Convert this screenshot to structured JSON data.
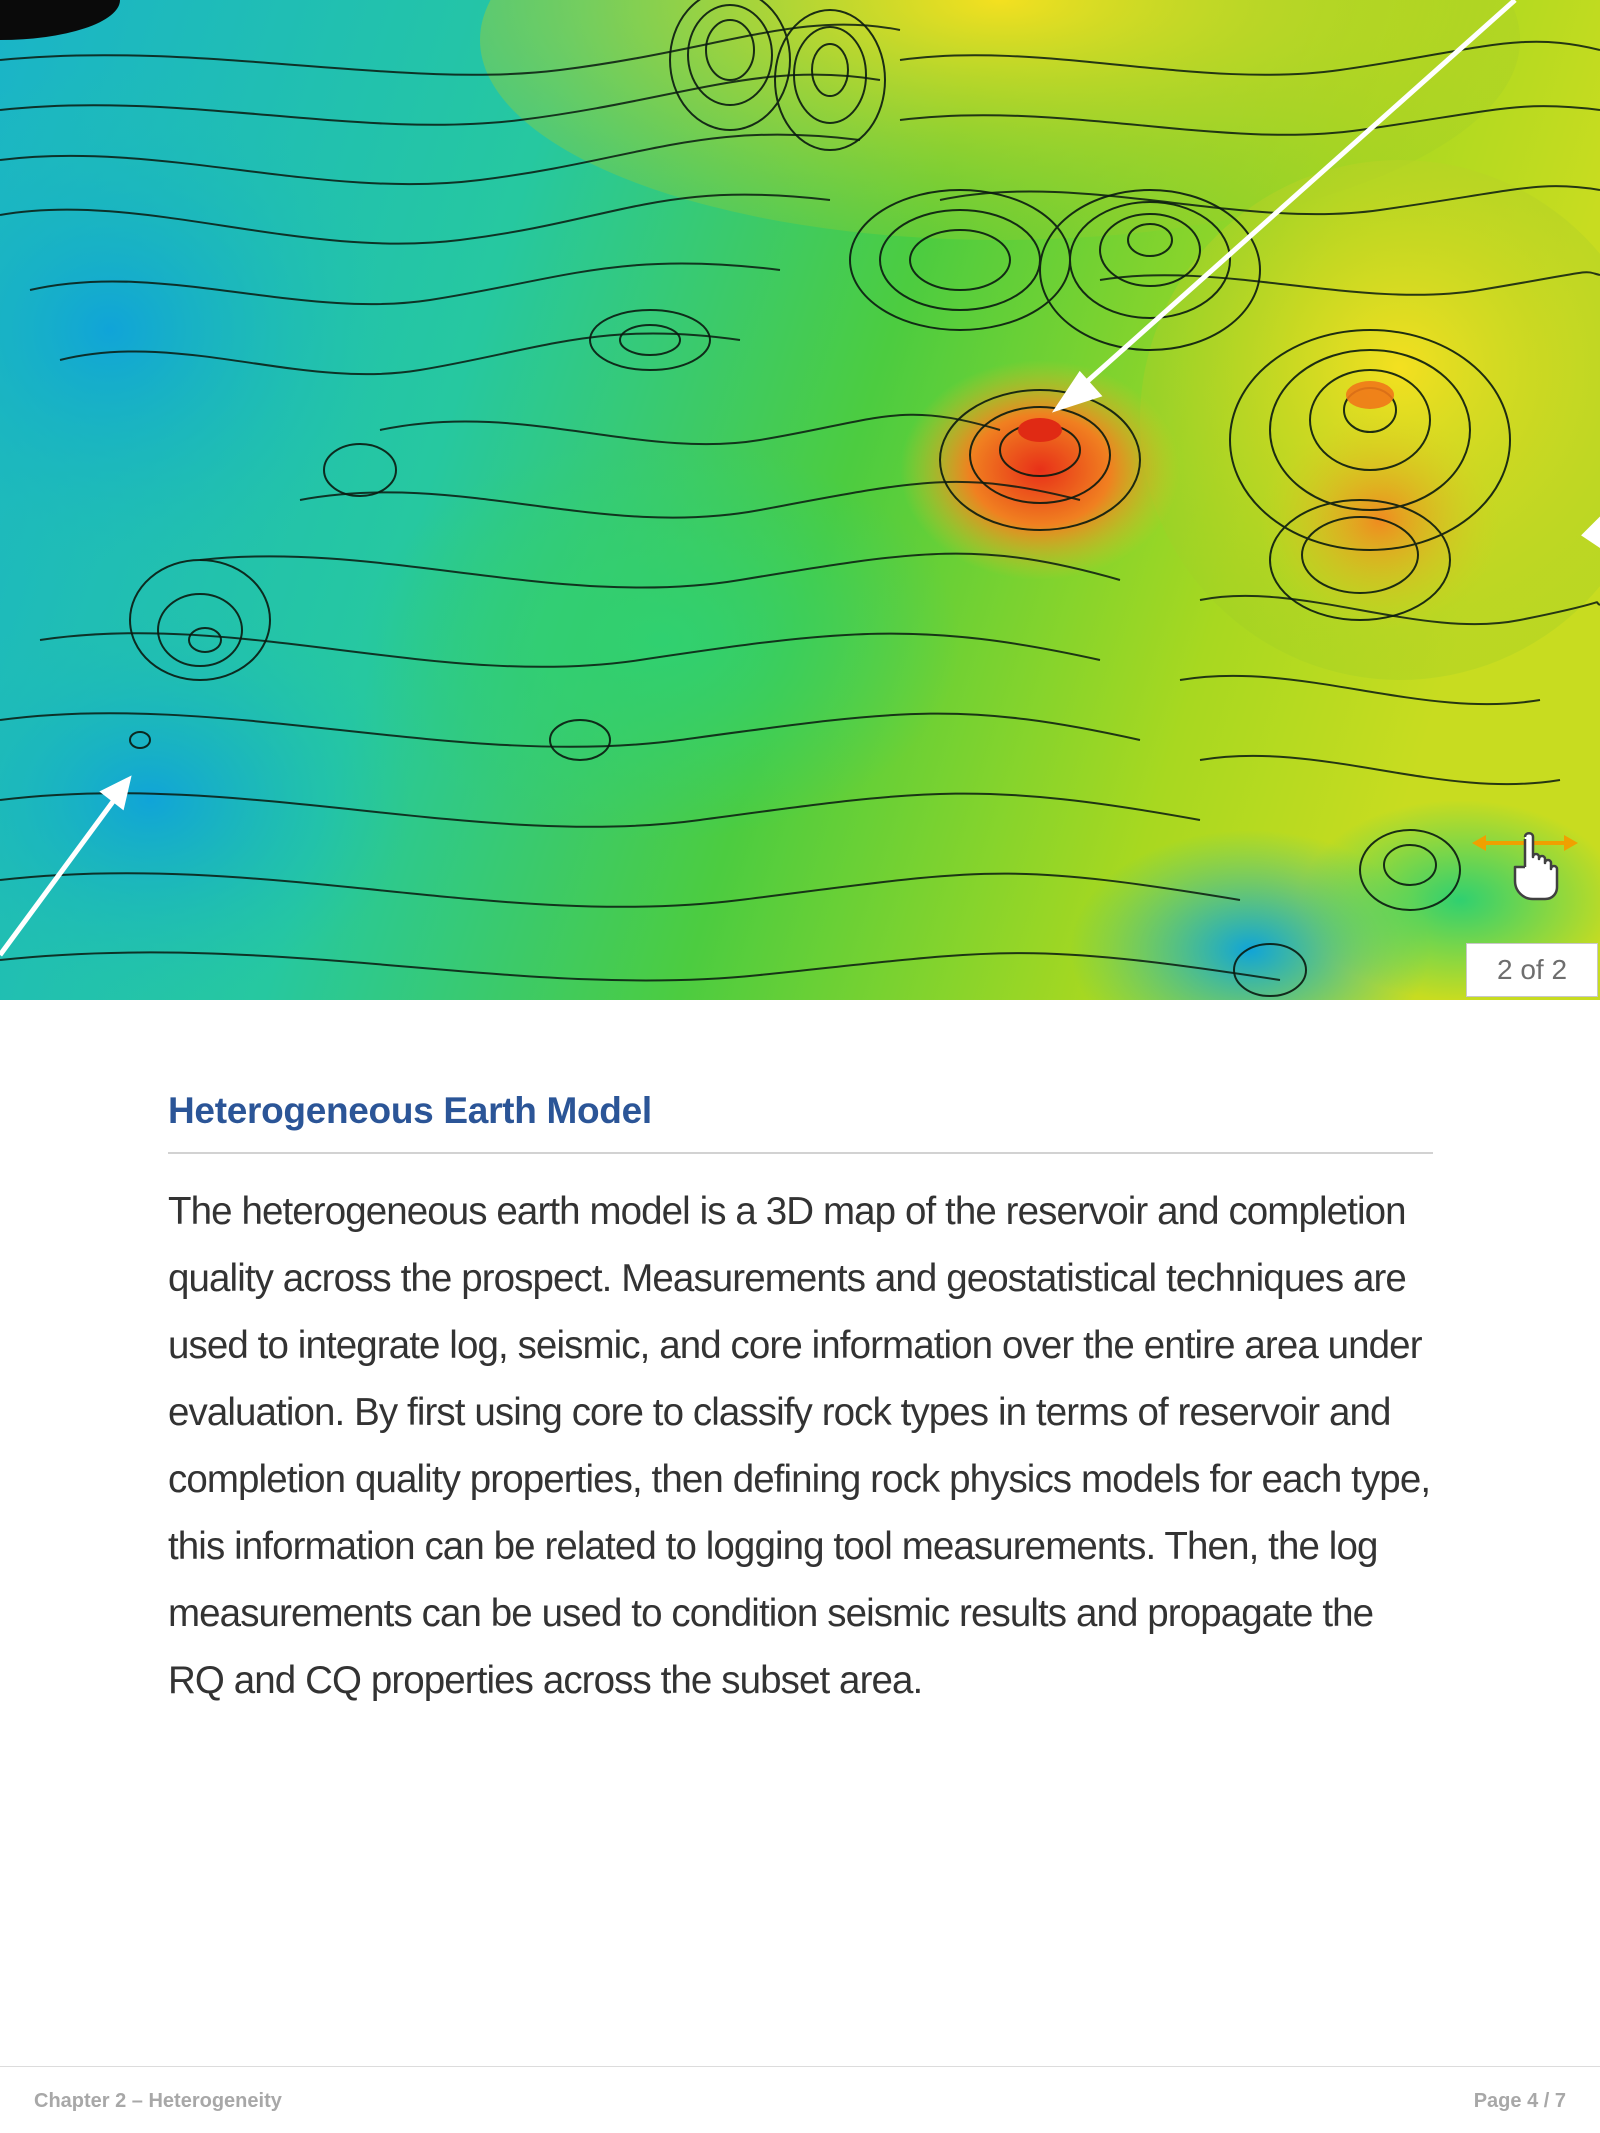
{
  "gallery": {
    "counter": "2 of 2",
    "image_icon": "contour-surface-3d-image",
    "swipe_icon": "swipe-hand-icon",
    "accent_color": "#f0a000"
  },
  "article": {
    "title": "Heterogeneous Earth Model",
    "body": "The heterogeneous earth model is a 3D map of the reservoir and completion quality across the prospect. Measurements and geostatistical techniques are used to integrate log, seismic, and core information over the entire area under evaluation. By first using core to classify rock types in terms of reservoir and completion quality properties, then defining rock physics models for each type, this information can be related to logging tool measurements. Then, the log measurements can be used to condition seismic results and propagate the RQ and CQ properties across the subset area."
  },
  "footer": {
    "chapter": "Chapter 2 – Heterogeneity",
    "page": "Page 4 / 7"
  }
}
